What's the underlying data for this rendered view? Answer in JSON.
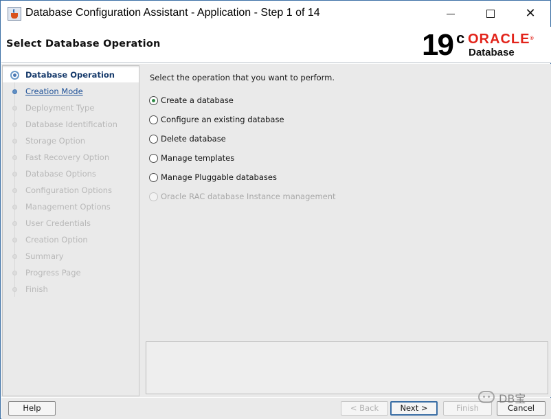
{
  "window": {
    "title": "Database Configuration Assistant - Application - Step 1 of 14",
    "minimize_glyph": "",
    "close_glyph": "✕"
  },
  "header": {
    "title": "Select Database Operation",
    "logo": {
      "version": "19",
      "version_suffix": "c",
      "brand": "ORACLE",
      "brand_mark": "®",
      "product": "Database"
    }
  },
  "nav": {
    "items": [
      {
        "label": "Database Operation",
        "state": "current"
      },
      {
        "label": "Creation Mode",
        "state": "next"
      },
      {
        "label": "Deployment Type",
        "state": "disabled"
      },
      {
        "label": "Database Identification",
        "state": "disabled"
      },
      {
        "label": "Storage Option",
        "state": "disabled"
      },
      {
        "label": "Fast Recovery Option",
        "state": "disabled"
      },
      {
        "label": "Database Options",
        "state": "disabled"
      },
      {
        "label": "Configuration Options",
        "state": "disabled"
      },
      {
        "label": "Management Options",
        "state": "disabled"
      },
      {
        "label": "User Credentials",
        "state": "disabled"
      },
      {
        "label": "Creation Option",
        "state": "disabled"
      },
      {
        "label": "Summary",
        "state": "disabled"
      },
      {
        "label": "Progress Page",
        "state": "disabled"
      },
      {
        "label": "Finish",
        "state": "disabled"
      }
    ]
  },
  "main": {
    "prompt": "Select the operation that you want to perform.",
    "options": [
      {
        "label": "Create a database",
        "checked": true,
        "enabled": true
      },
      {
        "label": "Configure an existing database",
        "checked": false,
        "enabled": true
      },
      {
        "label": "Delete database",
        "checked": false,
        "enabled": true
      },
      {
        "label": "Manage templates",
        "checked": false,
        "enabled": true
      },
      {
        "label": "Manage Pluggable databases",
        "checked": false,
        "enabled": true
      },
      {
        "label": "Oracle RAC database Instance management",
        "checked": false,
        "enabled": false
      }
    ]
  },
  "footer": {
    "help_label": "Help",
    "back_label": "< Back",
    "next_label": "Next >",
    "finish_label": "Finish",
    "cancel_label": "Cancel"
  },
  "watermark": {
    "text": "DB宝"
  },
  "colors": {
    "accent": "#4a78b3",
    "brand_red": "#e2231a",
    "selected_radio": "#2f8a46",
    "panel_bg": "#eaeaea"
  }
}
